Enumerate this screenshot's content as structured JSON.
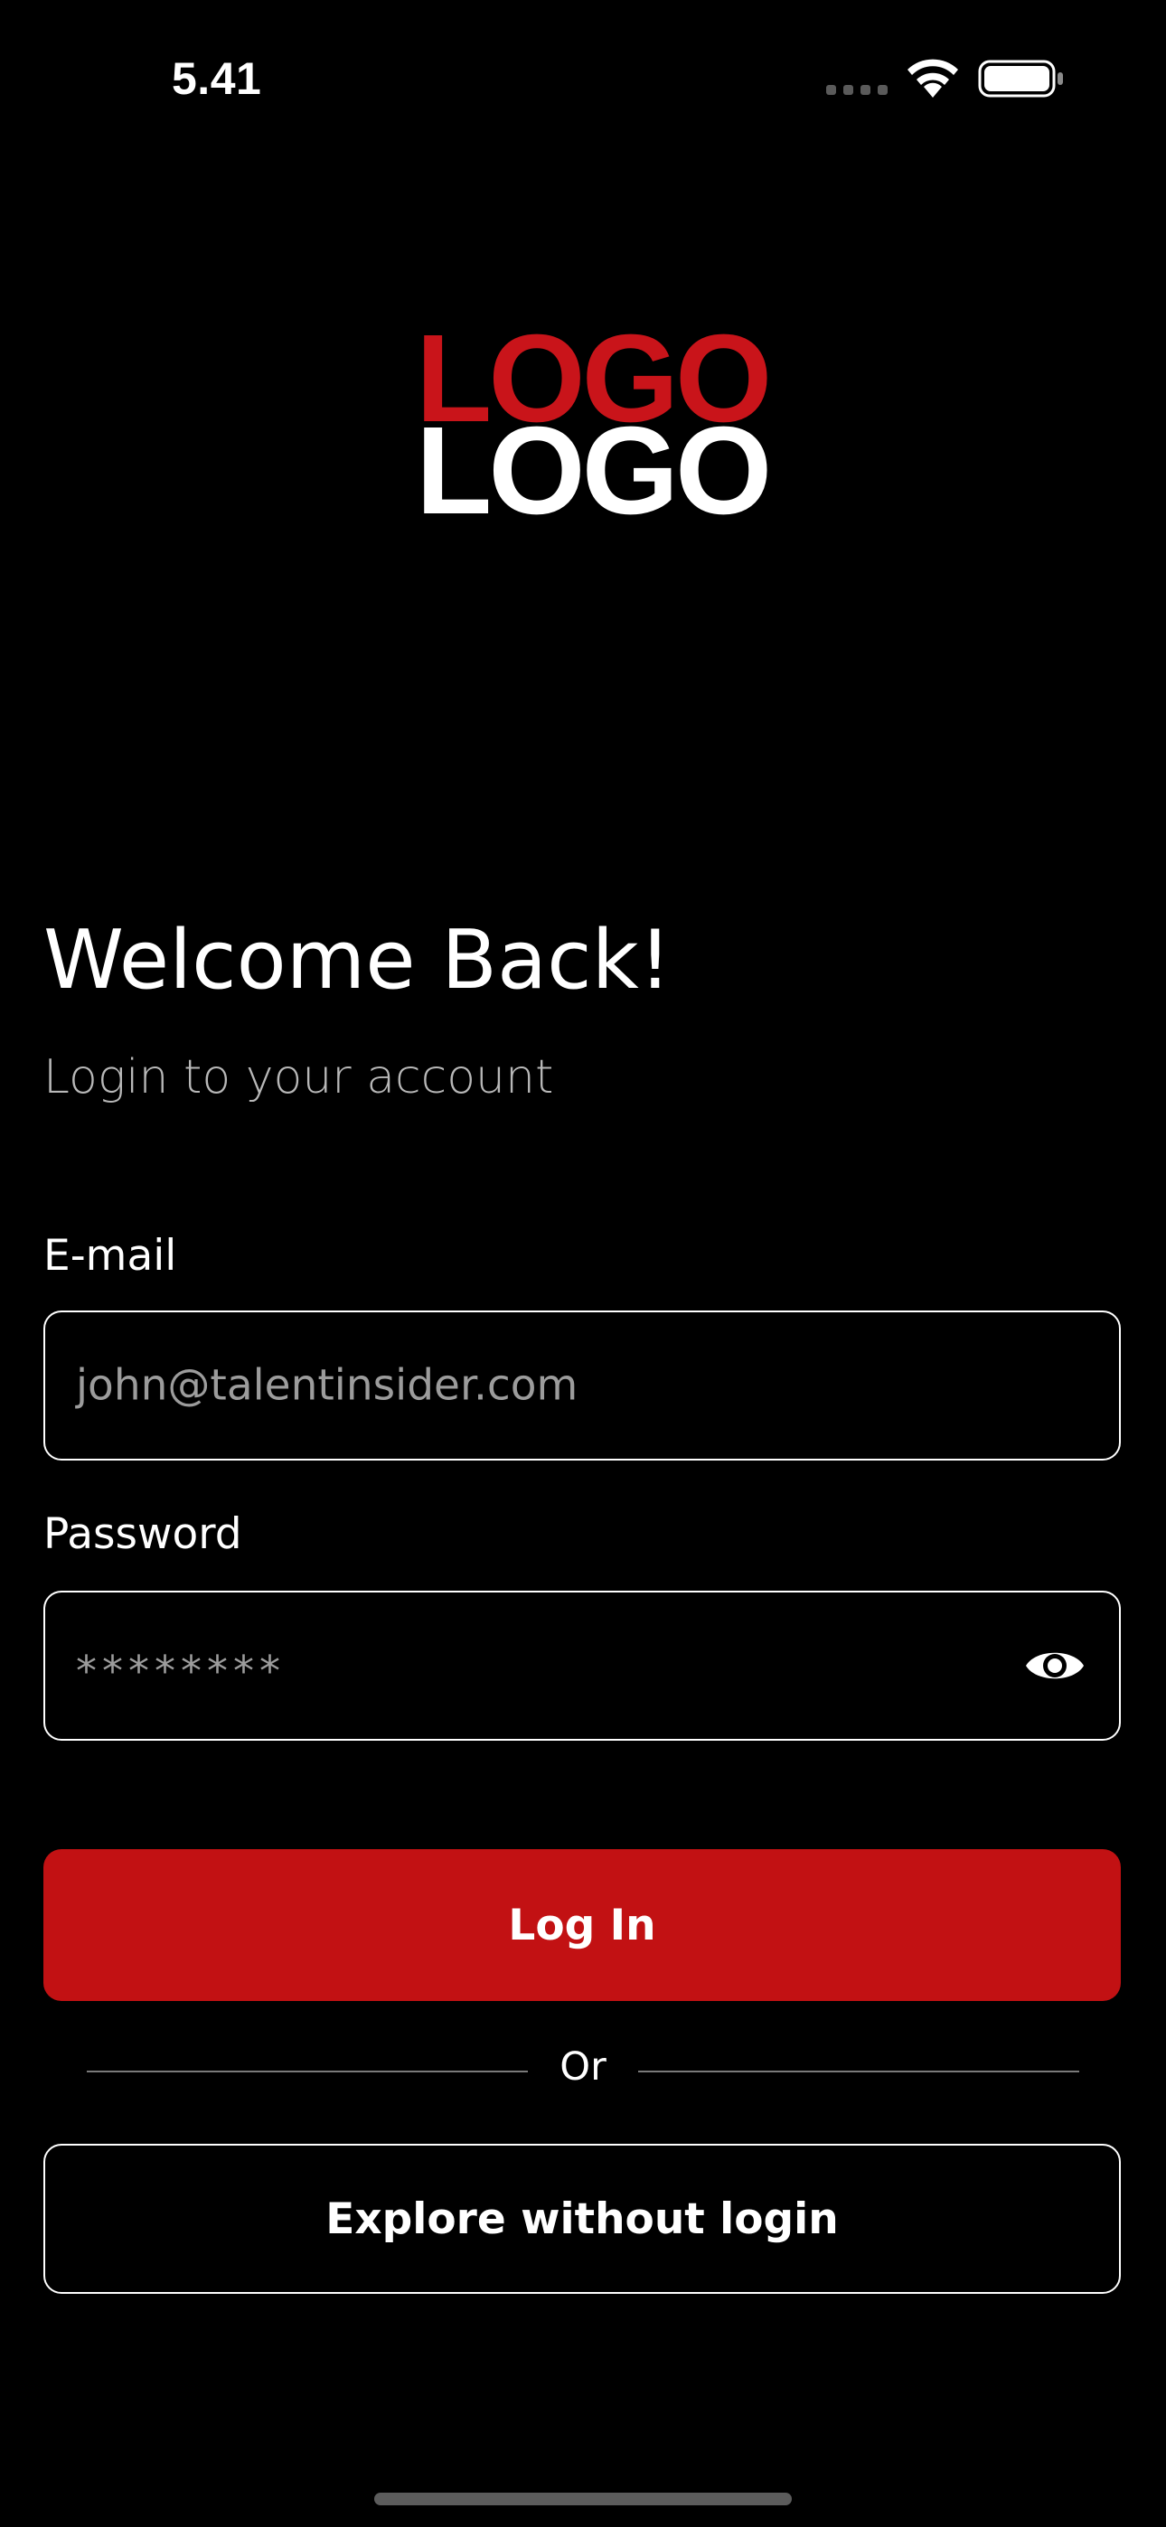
{
  "status_bar": {
    "time": "5.41"
  },
  "logo": {
    "top_text": "LOGO",
    "bottom_text": "LOGO",
    "top_color": "#c9141a",
    "bottom_color": "#ffffff"
  },
  "header": {
    "title": "Welcome Back!",
    "subtitle": "Login to your account"
  },
  "form": {
    "email_label": "E-mail",
    "email_placeholder": "john@talentinsider.com",
    "password_label": "Password",
    "password_value": "********",
    "show_password_icon": "eye-icon"
  },
  "actions": {
    "login_label": "Log In",
    "divider_text": "Or",
    "explore_label": "Explore without login"
  },
  "colors": {
    "background": "#000000",
    "accent": "#c21113",
    "placeholder": "#9c9c9c"
  }
}
